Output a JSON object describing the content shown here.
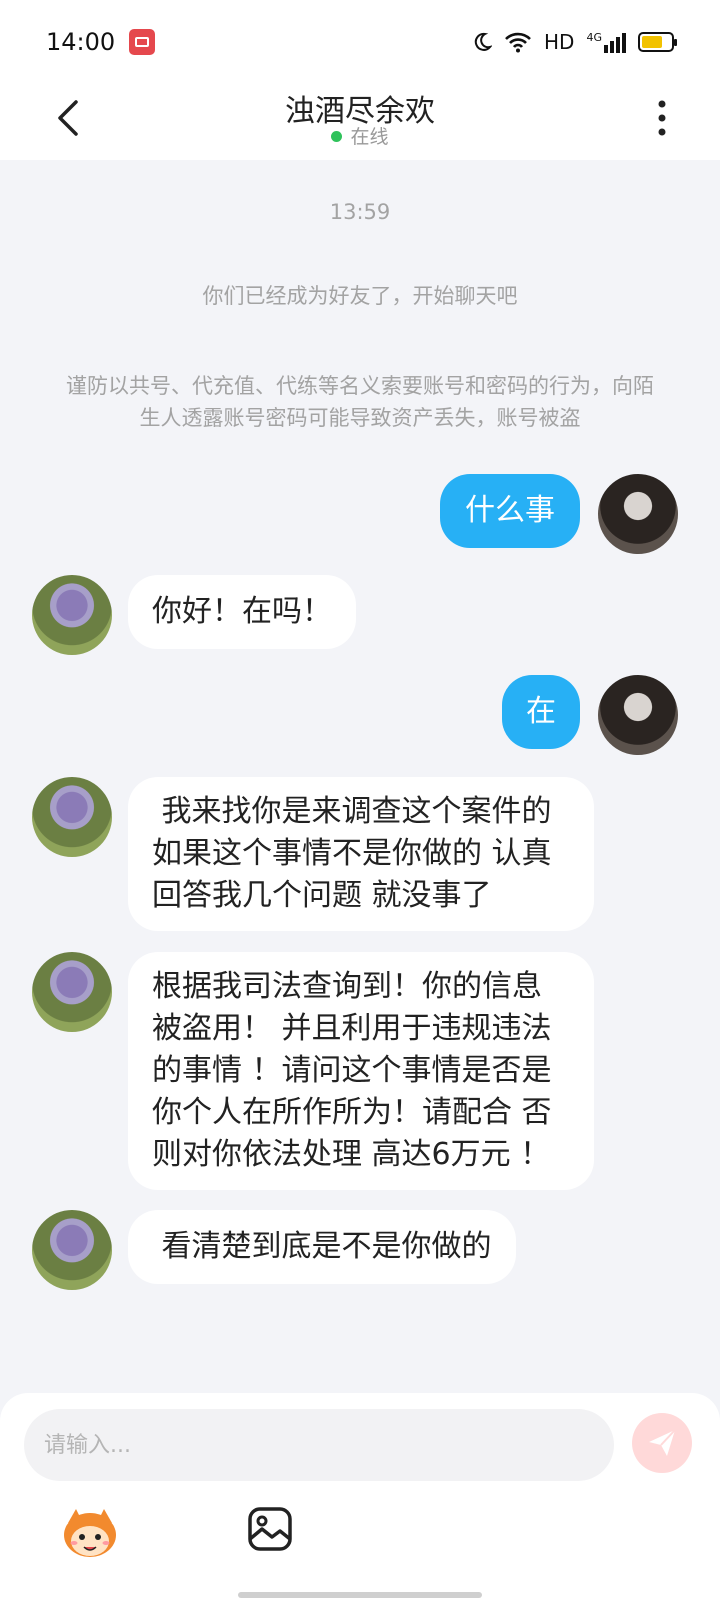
{
  "status_bar": {
    "time": "14:00",
    "network_label": "HD",
    "network_type": "4G",
    "icons": [
      "screen-record-icon",
      "moon-icon",
      "wifi-icon",
      "signal-icon",
      "battery-icon"
    ],
    "battery_level": 0.7,
    "battery_color": "#f2c200"
  },
  "header": {
    "title": "浊酒尽余欢",
    "status": "在线",
    "status_color": "#2fc25b"
  },
  "chat": {
    "time_divider": "13:59",
    "friend_notice": "你们已经成为好友了，开始聊天吧",
    "warning_notice": "谨防以共号、代充值、代练等名义索要账号和密码的行为，向陌生人透露账号密码可能导致资产丢失，账号被盗",
    "messages": [
      {
        "sender": "me",
        "text": "什么事"
      },
      {
        "sender": "other",
        "text": "你好！在吗！"
      },
      {
        "sender": "me",
        "text": "在"
      },
      {
        "sender": "other",
        "text": " 我来找你是来调查这个案件的\n如果这个事情不是你做的 认真\n回答我几个问题 就没事了"
      },
      {
        "sender": "other",
        "text": "根据我司法查询到！你的信息\n被盗用！ 并且利用于违规违法\n的事情 ！请问这个事情是否是\n你个人在所作所为！请配合 否\n则对你依法处理 高达6万元 ！"
      },
      {
        "sender": "other",
        "text": " 看清楚到底是不是你做的"
      }
    ],
    "bubble_color_me": "#27b0f5"
  },
  "composer": {
    "placeholder": "请输入...",
    "value": "",
    "send_icon": "send-icon",
    "tools": [
      "emoji-mascot-icon",
      "image-icon"
    ]
  }
}
